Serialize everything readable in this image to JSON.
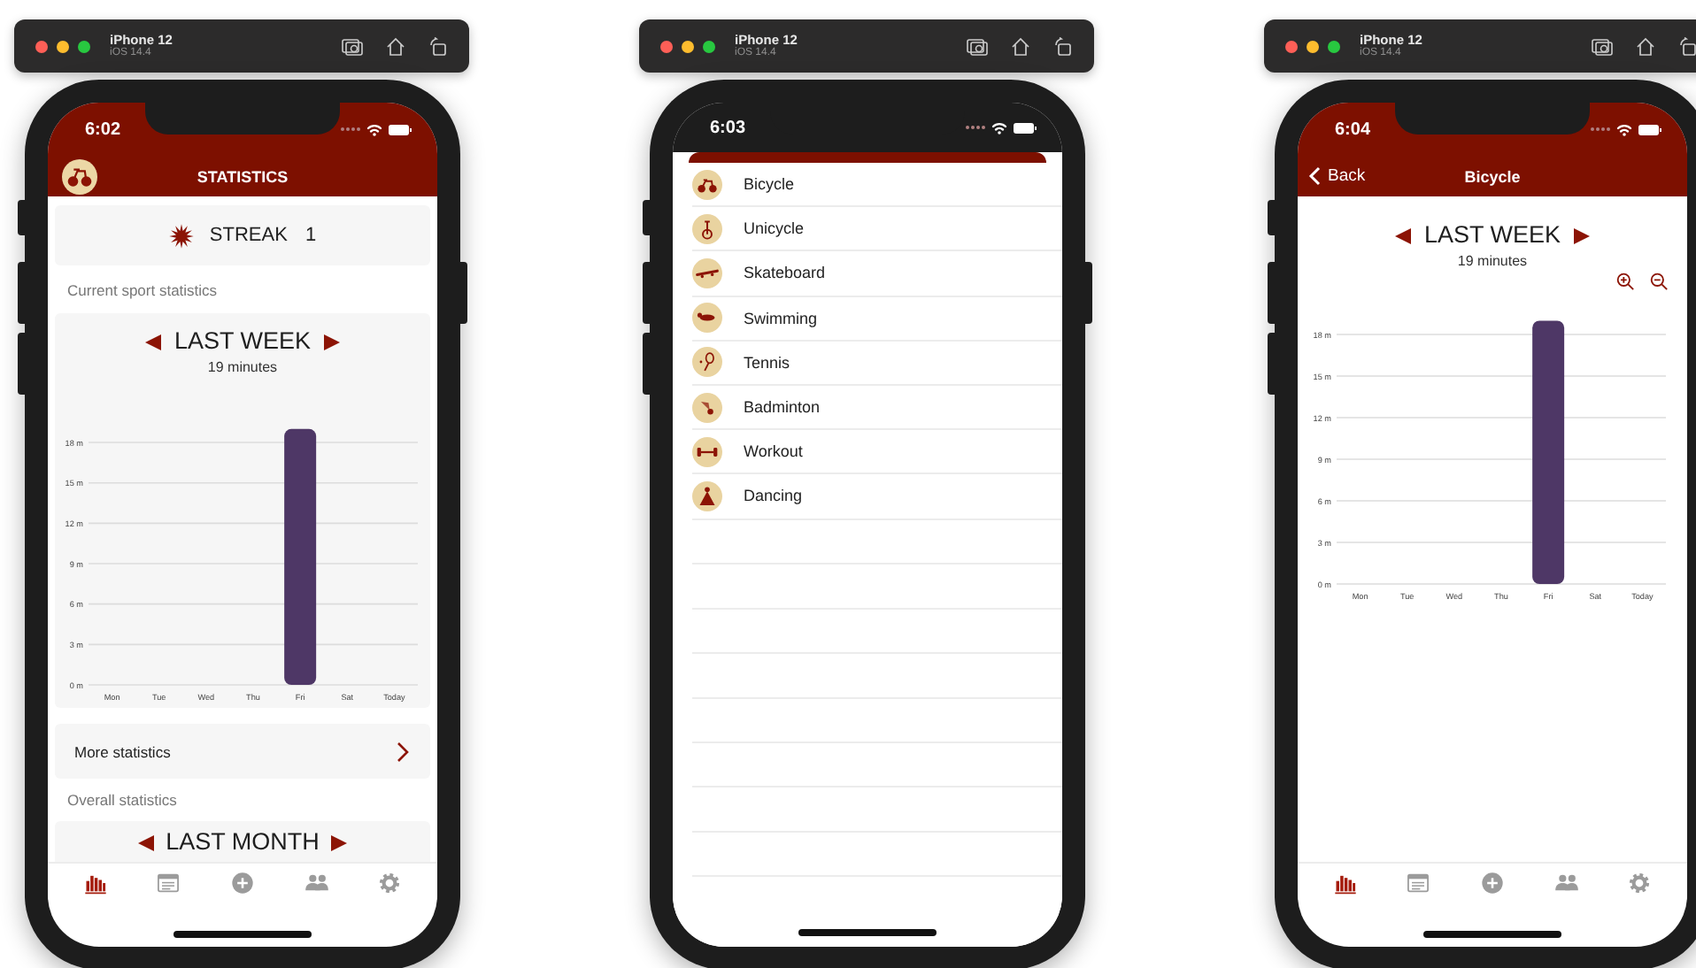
{
  "simulators": [
    {
      "device": "iPhone 12",
      "os": "iOS 14.4",
      "screen": {
        "kind": "statistics",
        "time": "6:02",
        "title": "STATISTICS",
        "streak": {
          "label": "STREAK",
          "value": "1"
        },
        "current_label": "Current sport statistics",
        "week_card": {
          "period": "LAST WEEK",
          "total": "19 minutes",
          "chart_data": {
            "type": "bar",
            "grid": true,
            "categories": [
              "Mon",
              "Tue",
              "Wed",
              "Thu",
              "Fri",
              "Sat",
              "Today"
            ],
            "values": [
              0,
              0,
              0,
              0,
              19,
              0,
              0
            ],
            "ylim": [
              0,
              19
            ],
            "yticks": [
              {
                "value": 0,
                "label": "0 m"
              },
              {
                "value": 3,
                "label": "3 m"
              },
              {
                "value": 6,
                "label": "6 m"
              },
              {
                "value": 9,
                "label": "9 m"
              },
              {
                "value": 12,
                "label": "12 m"
              },
              {
                "value": 15,
                "label": "15 m"
              },
              {
                "value": 18,
                "label": "18 m"
              }
            ]
          }
        },
        "more_link": "More statistics",
        "overall_label": "Overall statistics",
        "month_card": {
          "period": "LAST MONTH"
        },
        "tab_bar": [
          {
            "kind": "stats",
            "selected": true
          },
          {
            "kind": "calendar",
            "selected": false
          },
          {
            "kind": "add",
            "selected": false
          },
          {
            "kind": "people",
            "selected": false
          },
          {
            "kind": "settings",
            "selected": false
          }
        ]
      }
    },
    {
      "device": "iPhone 12",
      "os": "iOS 14.4",
      "screen": {
        "kind": "picker",
        "time": "6:03",
        "sports": [
          {
            "kind": "bicycle",
            "label": "Bicycle"
          },
          {
            "kind": "unicycle",
            "label": "Unicycle"
          },
          {
            "kind": "skateboard",
            "label": "Skateboard"
          },
          {
            "kind": "swimming",
            "label": "Swimming"
          },
          {
            "kind": "tennis",
            "label": "Tennis"
          },
          {
            "kind": "badminton",
            "label": "Badminton"
          },
          {
            "kind": "workout",
            "label": "Workout"
          },
          {
            "kind": "dancing",
            "label": "Dancing"
          }
        ]
      }
    },
    {
      "device": "iPhone 12",
      "os": "iOS 14.4",
      "screen": {
        "kind": "detail",
        "time": "6:04",
        "back": "Back",
        "title": "Bicycle",
        "period": "LAST WEEK",
        "total": "19 minutes",
        "chart_data": {
          "type": "bar",
          "grid": true,
          "categories": [
            "Mon",
            "Tue",
            "Wed",
            "Thu",
            "Fri",
            "Sat",
            "Today"
          ],
          "values": [
            0,
            0,
            0,
            0,
            19,
            0,
            0
          ],
          "ylim": [
            0,
            19
          ],
          "yticks": [
            {
              "value": 0,
              "label": "0 m"
            },
            {
              "value": 3,
              "label": "3 m"
            },
            {
              "value": 6,
              "label": "6 m"
            },
            {
              "value": 9,
              "label": "9 m"
            },
            {
              "value": 12,
              "label": "12 m"
            },
            {
              "value": 15,
              "label": "15 m"
            },
            {
              "value": 18,
              "label": "18 m"
            }
          ]
        },
        "tab_bar": [
          {
            "kind": "stats",
            "selected": true
          },
          {
            "kind": "calendar",
            "selected": false
          },
          {
            "kind": "add",
            "selected": false
          },
          {
            "kind": "people",
            "selected": false
          },
          {
            "kind": "settings",
            "selected": false
          }
        ]
      }
    }
  ]
}
